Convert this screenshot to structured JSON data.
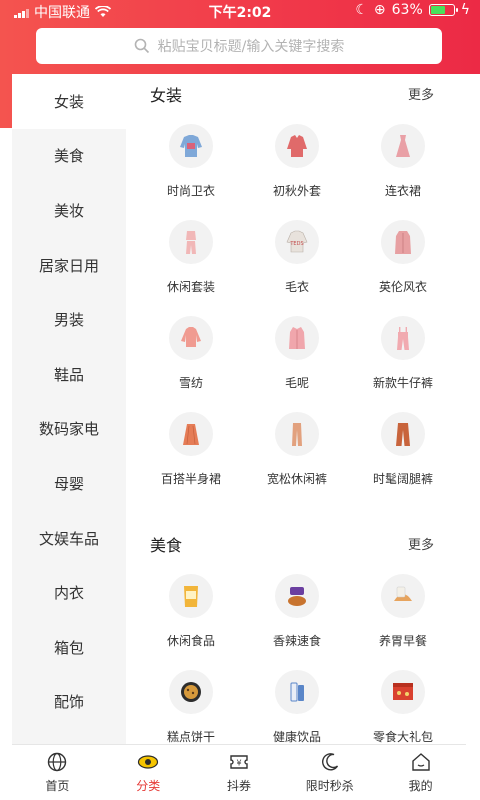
{
  "status": {
    "carrier": "中国联通",
    "time": "下午2:02",
    "battery": "63%"
  },
  "search": {
    "placeholder": "粘贴宝贝标题/输入关键字搜索"
  },
  "sidebar": {
    "items": [
      {
        "label": "女装",
        "active": true
      },
      {
        "label": "美食"
      },
      {
        "label": "美妆"
      },
      {
        "label": "居家日用"
      },
      {
        "label": "男装"
      },
      {
        "label": "鞋品"
      },
      {
        "label": "数码家电"
      },
      {
        "label": "母婴"
      },
      {
        "label": "文娱车品"
      },
      {
        "label": "内衣"
      },
      {
        "label": "箱包"
      },
      {
        "label": "配饰"
      }
    ]
  },
  "sections": [
    {
      "title": "女装",
      "more": "更多",
      "items": [
        {
          "label": "时尚卫衣",
          "icon": "sweatshirt-icon",
          "color": "#7fa8d8"
        },
        {
          "label": "初秋外套",
          "icon": "jacket-icon",
          "color": "#e06a6a"
        },
        {
          "label": "连衣裙",
          "icon": "dress-icon",
          "color": "#e9a0a6"
        },
        {
          "label": "休闲套装",
          "icon": "set-icon",
          "color": "#f1b7b7"
        },
        {
          "label": "毛衣",
          "icon": "sweater-icon",
          "color": "#e8e2dc"
        },
        {
          "label": "英伦风衣",
          "icon": "trenchcoat-icon",
          "color": "#e7a0a2"
        },
        {
          "label": "雪纺",
          "icon": "chiffon-icon",
          "color": "#f09b91"
        },
        {
          "label": "毛呢",
          "icon": "woolcoat-icon",
          "color": "#f0a6ac"
        },
        {
          "label": "新款牛仔裤",
          "icon": "overalls-icon",
          "color": "#f1aab0"
        },
        {
          "label": "百搭半身裙",
          "icon": "skirt-icon",
          "color": "#e57c56"
        },
        {
          "label": "宽松休闲裤",
          "icon": "trousers-icon",
          "color": "#e2a17e"
        },
        {
          "label": "时髦阔腿裤",
          "icon": "wide-pants-icon",
          "color": "#c8643c"
        }
      ]
    },
    {
      "title": "美食",
      "more": "更多",
      "items": [
        {
          "label": "休闲食品",
          "icon": "snack-bag-icon",
          "color": "#f2b53a"
        },
        {
          "label": "香辣速食",
          "icon": "spicy-food-icon",
          "color": "#c8742f"
        },
        {
          "label": "养胃早餐",
          "icon": "bread-icon",
          "color": "#e7a45e"
        },
        {
          "label": "糕点饼干",
          "icon": "cookie-icon",
          "color": "#d79a3c"
        },
        {
          "label": "健康饮品",
          "icon": "drink-icon",
          "color": "#5a86c8"
        },
        {
          "label": "零食大礼包",
          "icon": "gift-box-icon",
          "color": "#d9412f"
        }
      ]
    }
  ],
  "tabbar": {
    "items": [
      {
        "label": "首页",
        "icon": "globe-icon"
      },
      {
        "label": "分类",
        "icon": "eye-icon",
        "active": true
      },
      {
        "label": "抖券",
        "icon": "coupon-icon"
      },
      {
        "label": "限时秒杀",
        "icon": "moon-icon"
      },
      {
        "label": "我的",
        "icon": "home-icon"
      }
    ]
  },
  "colors": {
    "accent": "#e53935",
    "header_gradient_start": "#f4544f",
    "header_gradient_end": "#ec2a45",
    "sidebar_bg": "#f5f5f5"
  }
}
